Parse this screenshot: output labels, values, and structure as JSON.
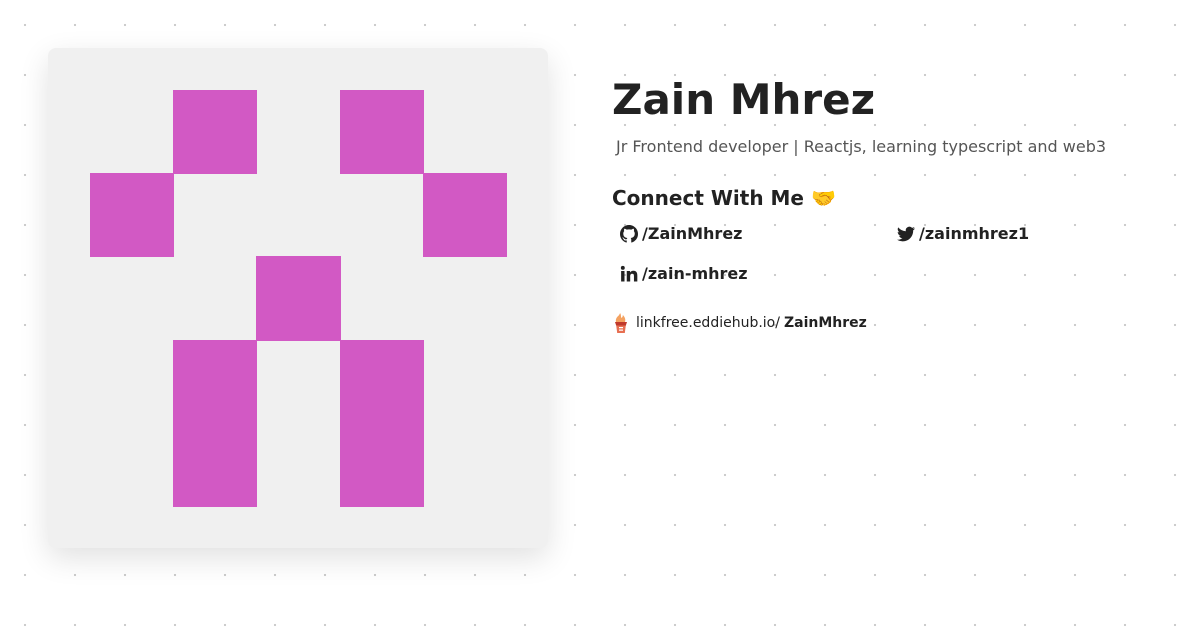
{
  "profile": {
    "name": "Zain Mhrez",
    "bio": "Jr Frontend developer | Reactjs, learning typescript and web3"
  },
  "avatar": {
    "background_color": "#f0f0f0",
    "block_color": "#d259c4"
  },
  "connect": {
    "heading": "Connect With Me 🤝"
  },
  "socials": [
    {
      "platform": "github",
      "icon": "github-icon",
      "handle": "/ZainMhrez"
    },
    {
      "platform": "twitter",
      "icon": "twitter-icon",
      "handle": "/zainmhrez1"
    },
    {
      "platform": "linkedin",
      "icon": "linkedin-icon",
      "handle": "/zain-mhrez"
    }
  ],
  "linkfree": {
    "icon": "linkfree-icon",
    "domain": "linkfree.eddiehub.io/",
    "username": "ZainMhrez"
  }
}
